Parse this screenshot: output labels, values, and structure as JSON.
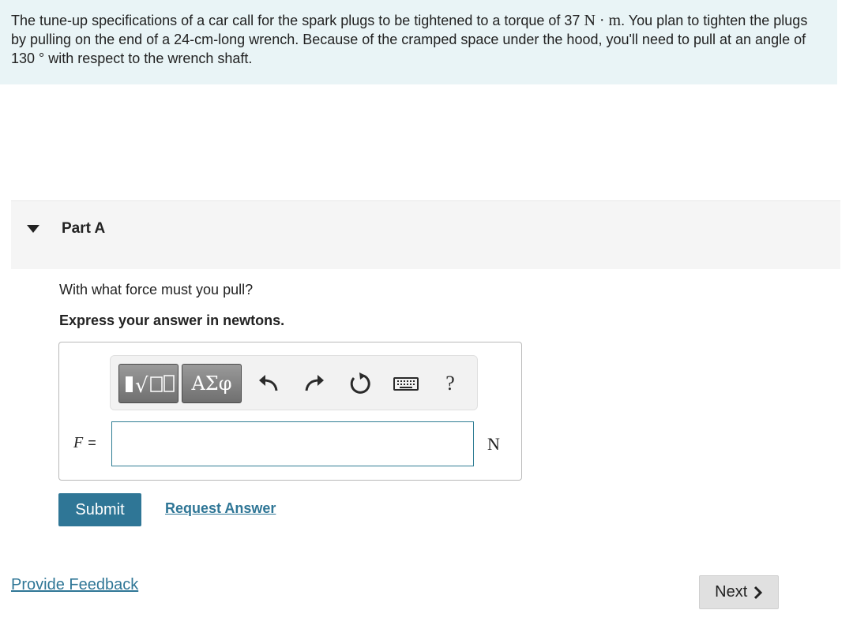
{
  "problem": {
    "text_1": "The tune-up specifications of a car call for the spark plugs to be tightened to a torque of 37 ",
    "unit_torque": "N · m",
    "text_2": ". You plan to tighten the plugs by pulling on the end of a 24-cm-long wrench. Because of the cramped space under the hood, you'll need to pull at an angle of 130 ",
    "degree": "°",
    "text_3": " with respect to the wrench shaft."
  },
  "part": {
    "title": "Part A",
    "question": "With what force must you pull?",
    "instruction": "Express your answer in newtons."
  },
  "toolbar": {
    "greek_label": "ΑΣφ",
    "help_label": "?",
    "icons": [
      "templates-icon",
      "greek-symbols-icon",
      "undo-icon",
      "redo-icon",
      "reset-icon",
      "keyboard-icon",
      "help-icon"
    ]
  },
  "answer": {
    "variable": "F",
    "equals": "=",
    "value": "",
    "unit": "N"
  },
  "actions": {
    "submit_label": "Submit",
    "request_label": "Request Answer",
    "feedback_label": "Provide Feedback",
    "next_label": "Next"
  },
  "colors": {
    "accent": "#2f7696",
    "problem_bg": "#e9f4f6",
    "part_header_bg": "#f5f5f5"
  }
}
